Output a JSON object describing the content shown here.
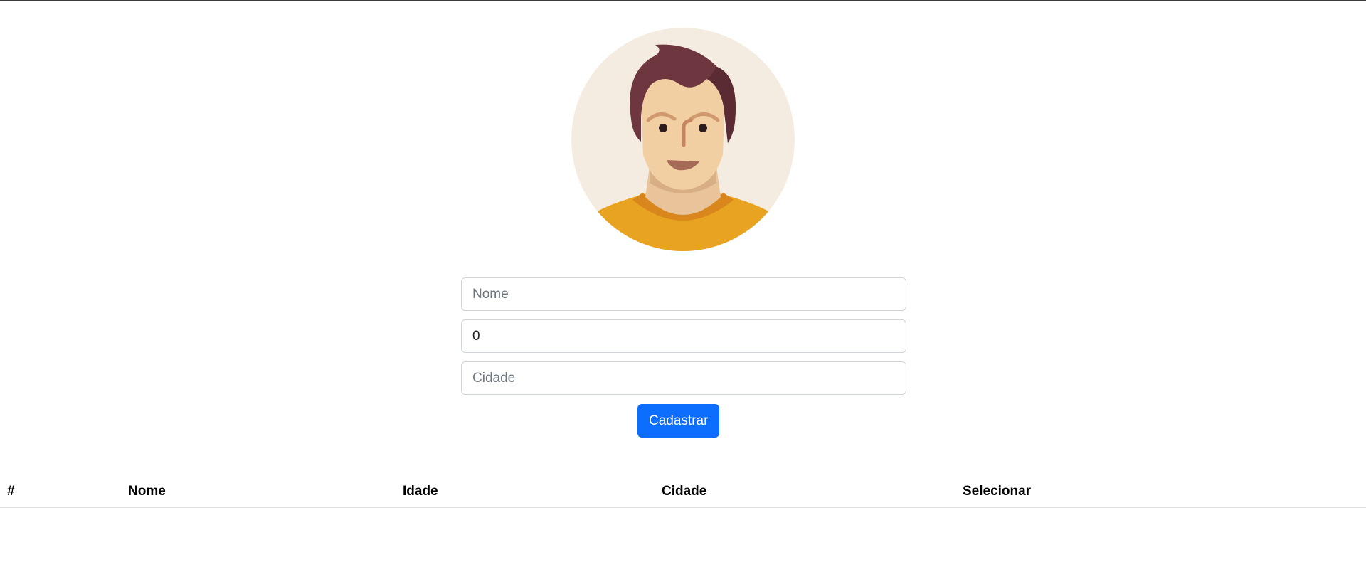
{
  "avatar": {
    "description_icon": "user-avatar-illustration"
  },
  "form": {
    "name": {
      "placeholder": "Nome",
      "value": ""
    },
    "age": {
      "placeholder": "",
      "value": "0"
    },
    "city": {
      "placeholder": "Cidade",
      "value": ""
    },
    "submit_label": "Cadastrar"
  },
  "table": {
    "headers": [
      "#",
      "Nome",
      "Idade",
      "Cidade",
      "Selecionar"
    ],
    "rows": []
  },
  "colors": {
    "primary": "#0d6efd",
    "border": "#ced4da"
  }
}
